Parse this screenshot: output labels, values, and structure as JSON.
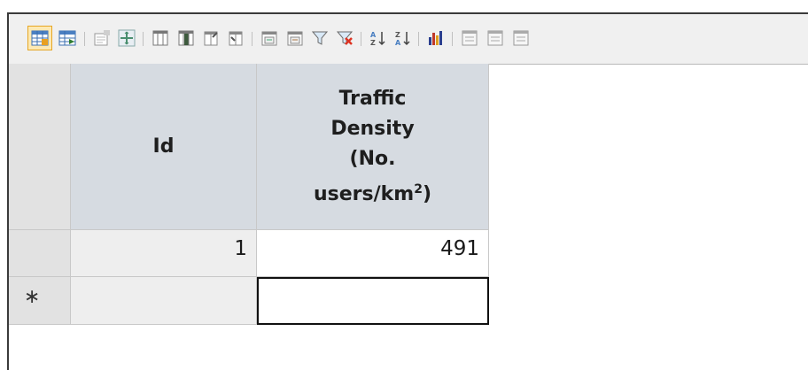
{
  "toolbar": {
    "buttons": [
      "datasheet-view-icon",
      "form-view-icon",
      "properties-icon",
      "zoom-icon",
      "columns-icon",
      "columns-select-icon",
      "freeze-columns-icon",
      "unfreeze-columns-icon",
      "print-icon",
      "print-preview-icon",
      "filter-icon",
      "clear-filter-icon",
      "sort-ascending-icon",
      "sort-descending-icon",
      "chart-icon",
      "record-first-icon",
      "record-next-icon",
      "record-last-icon"
    ]
  },
  "table": {
    "columns": [
      {
        "header": "Id"
      },
      {
        "header_line1": "Traffic",
        "header_line2": "Density",
        "header_line3": "(No.",
        "header_line4": "users/km",
        "header_sup": "2",
        "header_close": ")"
      }
    ],
    "rows": [
      {
        "id": "1",
        "traffic_density": "491"
      }
    ],
    "new_row_marker": "∗"
  }
}
